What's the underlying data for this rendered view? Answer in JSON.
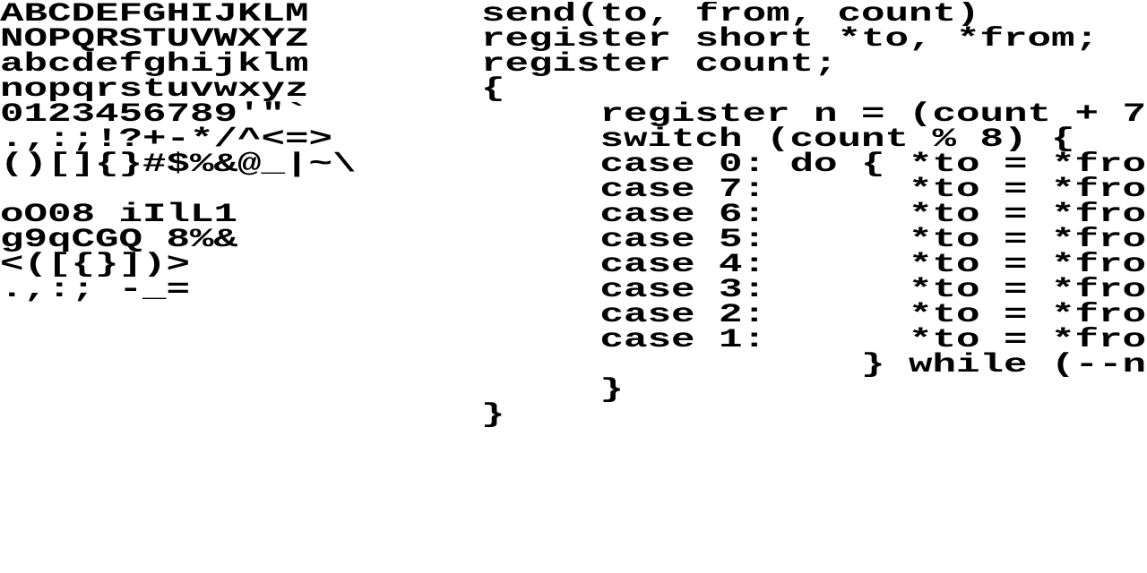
{
  "colors": {
    "background": "#ffffff",
    "text": "#000000"
  },
  "specimen": {
    "charset_lines": [
      "ABCDEFGHIJKLM",
      "NOPQRSTUVWXYZ",
      "abcdefghijklm",
      "nopqrstuvwxyz",
      "0123456789'\"`",
      ".,:;!?+-*/^<=>",
      "()[]{}#$%&@_|~\\",
      "",
      "oO08 iIlL1",
      "g9qCGQ 8%&",
      "<([{}])>",
      ".,:; -_="
    ]
  },
  "code_sample": {
    "lines": [
      "send(to, from, count)",
      "register short *to, *from;",
      "register count;",
      "{",
      "     register n = (count + 7",
      "     switch (count % 8) {",
      "     case 0: do { *to = *fro",
      "     case 7:      *to = *fro",
      "     case 6:      *to = *fro",
      "     case 5:      *to = *fro",
      "     case 4:      *to = *fro",
      "     case 3:      *to = *fro",
      "     case 2:      *to = *fro",
      "     case 1:      *to = *fro",
      "                } while (--n",
      "     }",
      "}"
    ]
  }
}
